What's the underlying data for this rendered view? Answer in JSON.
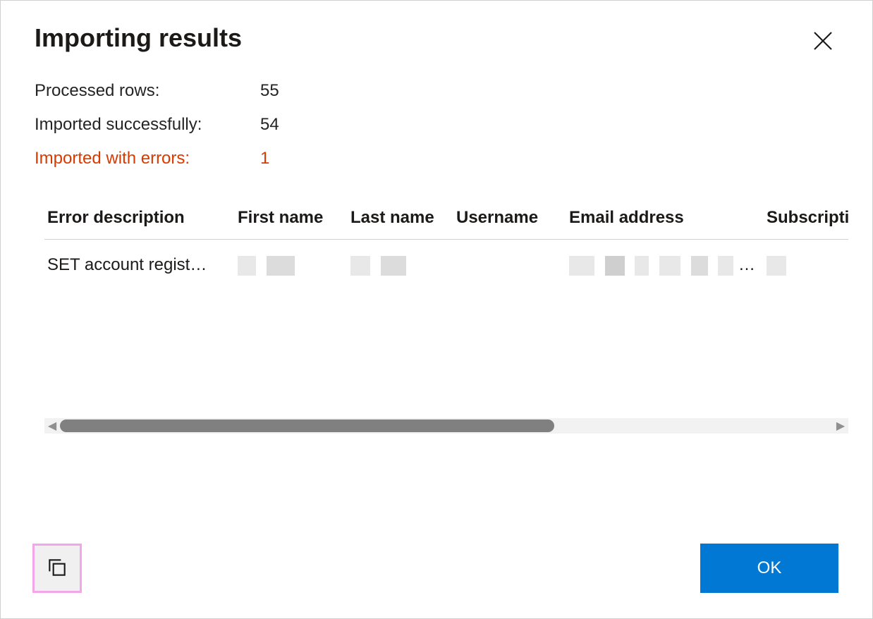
{
  "dialog": {
    "title": "Importing results",
    "close_icon": "close-icon"
  },
  "stats": {
    "processed_label": "Processed rows:",
    "processed_value": "55",
    "success_label": "Imported successfully:",
    "success_value": "54",
    "errors_label": "Imported with errors:",
    "errors_value": "1"
  },
  "table": {
    "headers": {
      "error_description": "Error description",
      "first_name": "First name",
      "last_name": "Last name",
      "username": "Username",
      "email_address": "Email address",
      "subscription": "Subscription"
    },
    "rows": [
      {
        "error_description": "SET account regist…",
        "first_name": "",
        "last_name": "",
        "username": "",
        "email_address": "",
        "subscription": ""
      }
    ]
  },
  "footer": {
    "copy_icon": "copy-icon",
    "ok_label": "OK"
  },
  "colors": {
    "error_text": "#d83b01",
    "primary_button": "#0078d4",
    "highlight_border": "#f3a6e8"
  }
}
